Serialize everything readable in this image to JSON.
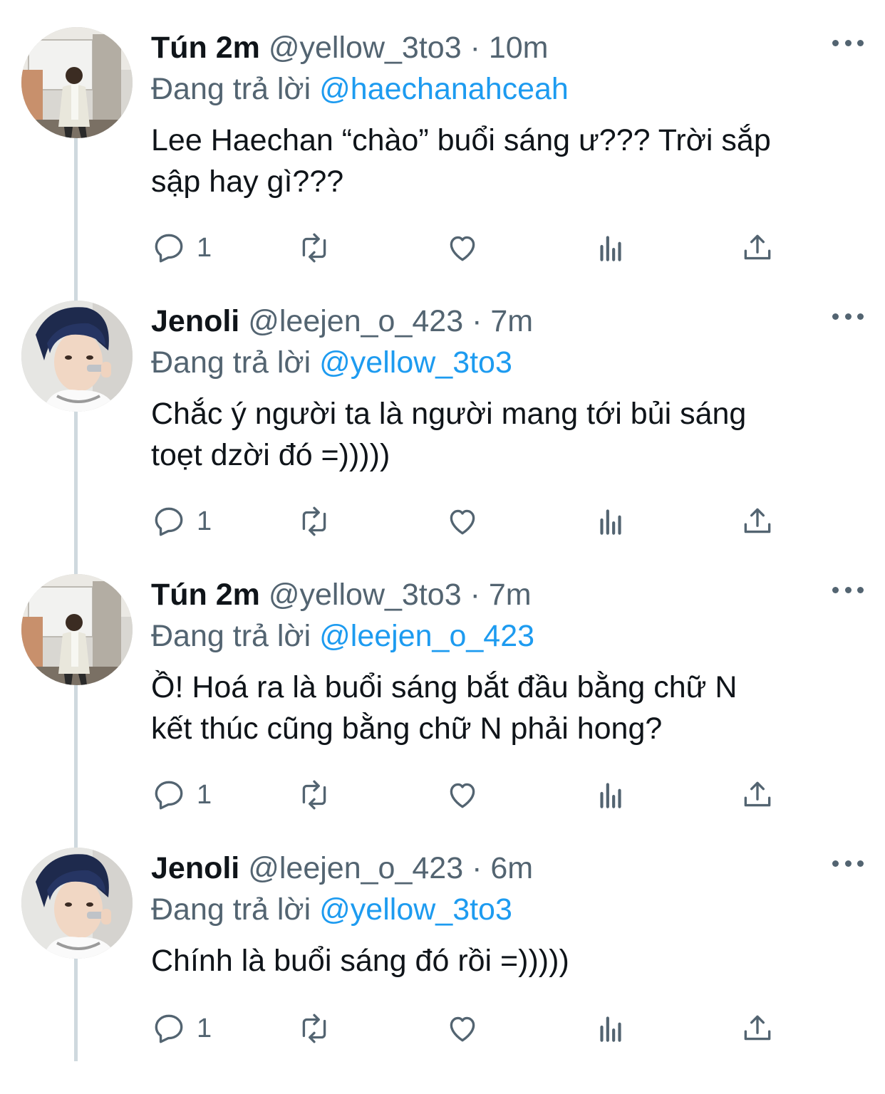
{
  "thread": [
    {
      "avatar": "user-avatar-yellow",
      "display_name": "Tún 2m",
      "handle": "@yellow_3to3",
      "separator": "·",
      "time": "10m",
      "reply_prefix": "Đang trả lời",
      "reply_to": "@haechanahceah",
      "text": "Lee Haechan “chào” buổi sáng ư??? Trời sắp\nsập hay gì???",
      "reply_count": "1"
    },
    {
      "avatar": "user-avatar-jenoli",
      "display_name": "Jenoli",
      "handle": "@leejen_o_423",
      "separator": "·",
      "time": "7m",
      "reply_prefix": "Đang trả lời",
      "reply_to": "@yellow_3to3",
      "text": "Chắc ý người ta là người mang tới bủi sáng\ntoẹt dzời đó =)))))",
      "reply_count": "1"
    },
    {
      "avatar": "user-avatar-yellow",
      "display_name": "Tún 2m",
      "handle": "@yellow_3to3",
      "separator": "·",
      "time": "7m",
      "reply_prefix": "Đang trả lời",
      "reply_to": "@leejen_o_423",
      "text": "Ồ! Hoá ra là buổi sáng bắt đầu bằng chữ N\nkết thúc cũng bằng chữ N phải hong?",
      "reply_count": "1"
    },
    {
      "avatar": "user-avatar-jenoli",
      "display_name": "Jenoli",
      "handle": "@leejen_o_423",
      "separator": "·",
      "time": "6m",
      "reply_prefix": "Đang trả lời",
      "reply_to": "@yellow_3to3",
      "text": "Chính là buổi sáng đó rồi =)))))",
      "reply_count": "1"
    }
  ],
  "icons": {
    "reply": "reply-icon",
    "retweet": "retweet-icon",
    "like": "like-icon",
    "views": "views-icon",
    "share": "share-icon",
    "more": "more-icon"
  },
  "colors": {
    "text": "#0f1419",
    "secondary": "#536471",
    "link": "#1d9bf0",
    "thread_line": "#cfd9de"
  }
}
